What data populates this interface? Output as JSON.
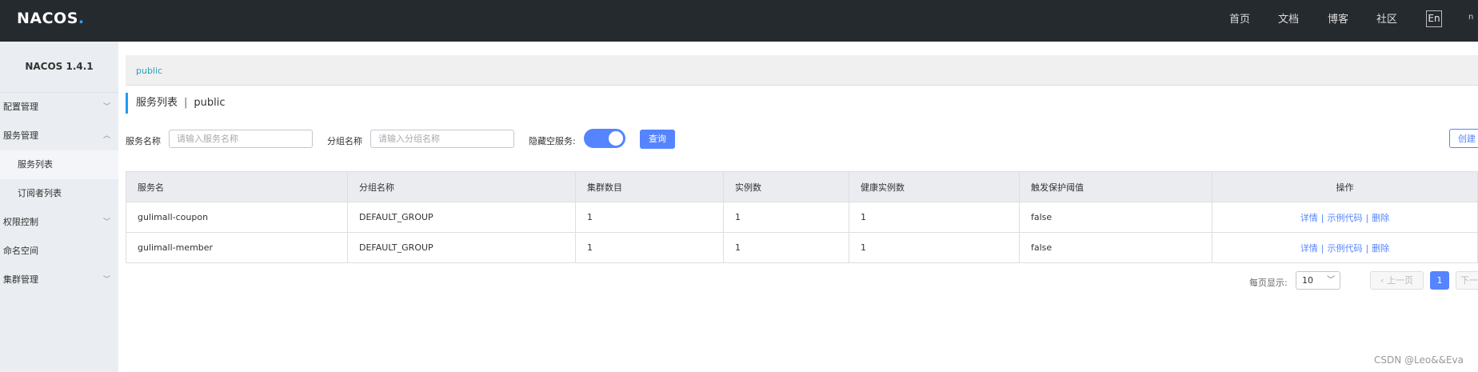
{
  "topbar": {
    "logo": "NACOS",
    "nav": [
      "首页",
      "文档",
      "博客",
      "社区"
    ],
    "lang": "En",
    "user_truncated": "n"
  },
  "sidebar": {
    "version": "NACOS 1.4.1",
    "items": [
      {
        "label": "配置管理",
        "icon": "chevron-down-icon"
      },
      {
        "label": "服务管理",
        "icon": "chevron-up-icon"
      },
      {
        "label": "服务列表",
        "sub": true,
        "active": true
      },
      {
        "label": "订阅者列表",
        "sub": true
      },
      {
        "label": "权限控制",
        "icon": "chevron-down-icon"
      },
      {
        "label": "命名空间"
      },
      {
        "label": "集群管理",
        "icon": "chevron-down-icon"
      }
    ]
  },
  "breadcrumb": "public",
  "page": {
    "title": "服务列表",
    "separator": "|",
    "namespace": "public"
  },
  "filters": {
    "service_label": "服务名称",
    "service_placeholder": "请输入服务名称",
    "group_label": "分组名称",
    "group_placeholder": "请输入分组名称",
    "hide_empty_label": "隐藏空服务:",
    "hide_empty_on": true,
    "query_label": "查询",
    "create_label": "创建"
  },
  "table": {
    "headers": [
      "服务名",
      "分组名称",
      "集群数目",
      "实例数",
      "健康实例数",
      "触发保护阈值",
      "操作"
    ],
    "rows": [
      [
        "gulimall-coupon",
        "DEFAULT_GROUP",
        "1",
        "1",
        "1",
        "false"
      ],
      [
        "gulimall-member",
        "DEFAULT_GROUP",
        "1",
        "1",
        "1",
        "false"
      ]
    ],
    "ops": {
      "detail": "详情",
      "sample": "示例代码",
      "delete": "删除",
      "sep": "|"
    }
  },
  "pager": {
    "page_size_label": "每页显示:",
    "page_size": "10",
    "prev": "上一页",
    "current": "1",
    "next": "下一页"
  },
  "watermark": "CSDN @Leo&&Eva",
  "colors": {
    "accent": "#5584ff",
    "topbar": "#252a2f",
    "sidebar": "#eaedf1",
    "link_teal": "#2aa0bb"
  }
}
